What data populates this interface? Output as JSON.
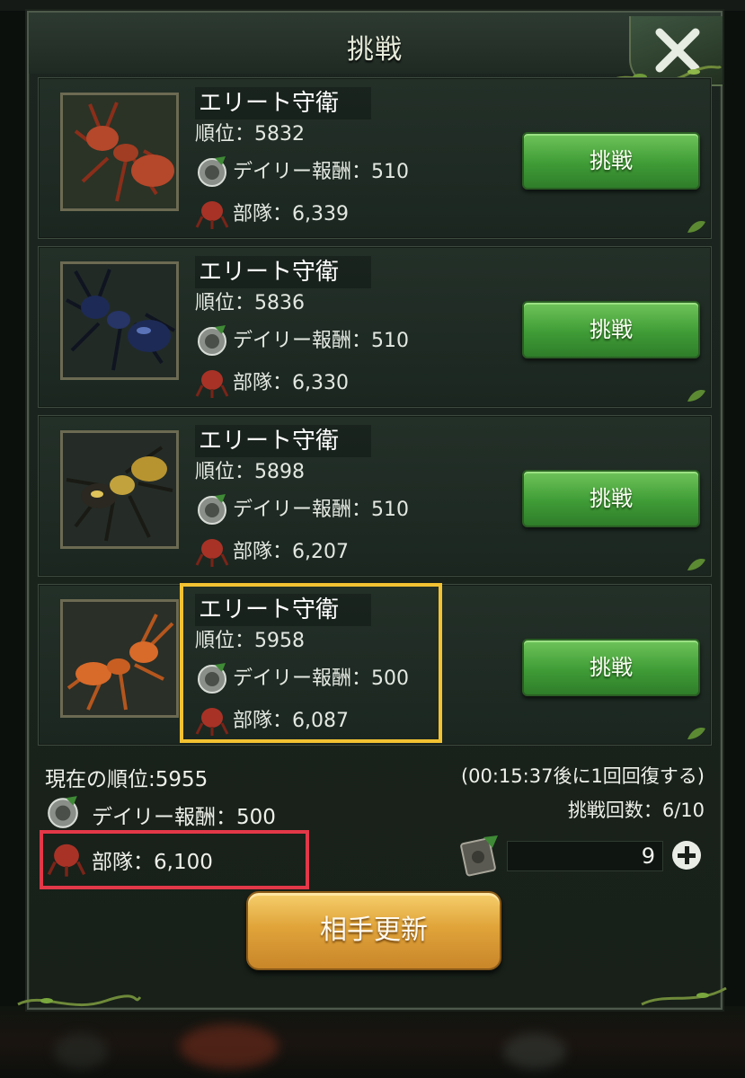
{
  "dialog": {
    "title": "挑戦",
    "close_icon": "close-x-icon"
  },
  "opponents": [
    {
      "name": "エリート守衛",
      "rank": "順位：5832",
      "reward": "デイリー報酬：510",
      "troops": "部隊：6,339",
      "button": "挑戦",
      "ant_color": "#b5472a"
    },
    {
      "name": "エリート守衛",
      "rank": "順位：5836",
      "reward": "デイリー報酬：510",
      "troops": "部隊：6,330",
      "button": "挑戦",
      "ant_color": "#1d2a55"
    },
    {
      "name": "エリート守衛",
      "rank": "順位：5898",
      "reward": "デイリー報酬：510",
      "troops": "部隊：6,207",
      "button": "挑戦",
      "ant_color": "#c2a23c"
    },
    {
      "name": "エリート守衛",
      "rank": "順位：5958",
      "reward": "デイリー報酬：500",
      "troops": "部隊：6,087",
      "button": "挑戦",
      "ant_color": "#d86a2a"
    }
  ],
  "footer": {
    "current_rank": "現在の順位:5955",
    "recovery": "(00:15:37後に1回回復する)",
    "daily_reward": "デイリー報酬：500",
    "attempts": "挑戦回数：6/10",
    "troops": "部隊：6,100",
    "ticket_count": "9",
    "refresh_button": "相手更新"
  },
  "colors": {
    "highlight_yellow": "#f2c232",
    "highlight_red": "#e23848",
    "challenge_green": "#3f9c36",
    "refresh_gold": "#e0a43a"
  }
}
